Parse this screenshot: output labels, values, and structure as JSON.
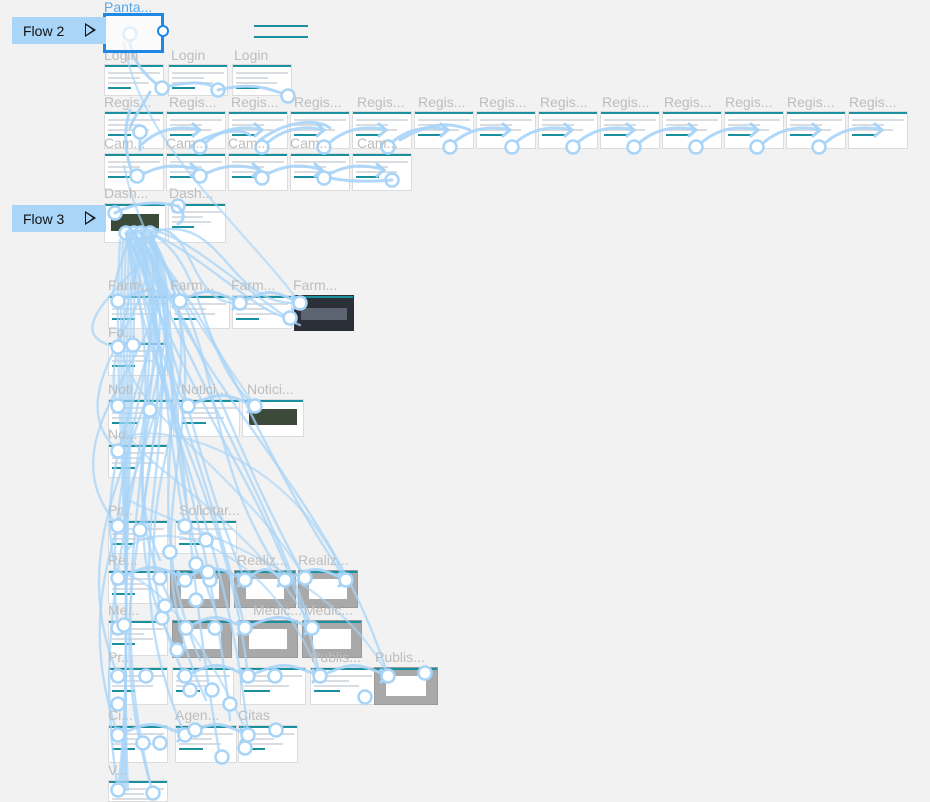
{
  "canvas": {
    "background": "#f2f2f2",
    "wire_color": "#a8d4f8",
    "wire_node_fill": "#ffffff",
    "accent": "#1a8f9e",
    "selection_color": "#1e88e5"
  },
  "flows": [
    {
      "label": "Flow 2",
      "icon": "play-icon"
    },
    {
      "label": "Flow 3",
      "icon": "play-icon"
    }
  ],
  "frame_labels": [
    "Panta...",
    "Login",
    "Login",
    "Login",
    "Regis...",
    "Regis...",
    "Regis...",
    "Regis...",
    "Regis...",
    "Regis...",
    "Regis...",
    "Regis...",
    "Regis...",
    "Regis...",
    "Regis...",
    "Regis...",
    "Regis...",
    "Cam...",
    "Cam...",
    "Cam...",
    "Cam...",
    "Cam...",
    "Dash...",
    "Dash...",
    "Farm...",
    "Farm...",
    "Farm...",
    "Farm...",
    "Fo...",
    "Noti...",
    "Notici...",
    "Notici...",
    "No...",
    "Pr...",
    "Solicitar...",
    "Re...",
    "Realiz...",
    "Realiz...",
    "Me...",
    "Medic...",
    "Medic...",
    "Pr...",
    "Publis...",
    "Publis...",
    "Ci...",
    "Agen...",
    "Citas",
    "V..."
  ]
}
